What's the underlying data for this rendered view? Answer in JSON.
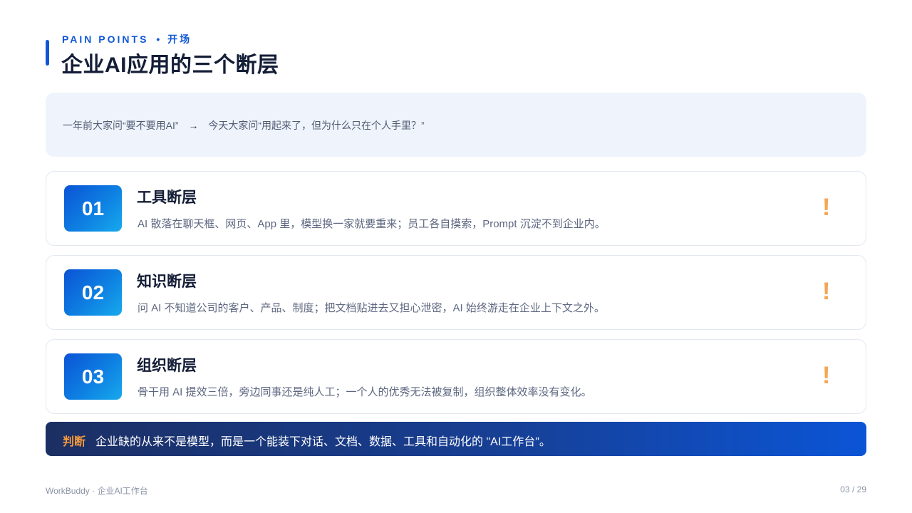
{
  "header": {
    "eyebrow": "PAIN POINTS",
    "eyebrow_separator": "•",
    "eyebrow_section": "开场",
    "title": "企业AI应用的三个断层"
  },
  "quote": {
    "before": "一年前大家问“要不要用AI”",
    "arrow": "→",
    "after": "今天大家问“用起来了，但为什么只在个人手里？”"
  },
  "cards": [
    {
      "number": "01",
      "title": "工具断层",
      "description": "AI 散落在聊天框、网页、App 里，模型换一家就要重来；员工各自摸索，Prompt 沉淀不到企业内。",
      "icon": "exclamation-icon",
      "icon_glyph": "!"
    },
    {
      "number": "02",
      "title": "知识断层",
      "description": "问 AI 不知道公司的客户、产品、制度；把文档贴进去又担心泄密，AI 始终游走在企业上下文之外。",
      "icon": "exclamation-icon",
      "icon_glyph": "!"
    },
    {
      "number": "03",
      "title": "组织断层",
      "description": "骨干用 AI 提效三倍，旁边同事还是纯人工；一个人的优秀无法被复制，组织整体效率没有变化。",
      "icon": "exclamation-icon",
      "icon_glyph": "!"
    }
  ],
  "verdict": {
    "label": "判断",
    "text": "企业缺的从来不是模型，而是一个能装下对话、文档、数据、工具和自动化的 \"AI工作台\"。"
  },
  "footer": {
    "brand": "WorkBuddy · 企业AI工作台",
    "page": "03 / 29"
  },
  "colors": {
    "accent": "#0f57d6",
    "warning": "#f5a653",
    "verdict_label": "#f49a3b"
  }
}
